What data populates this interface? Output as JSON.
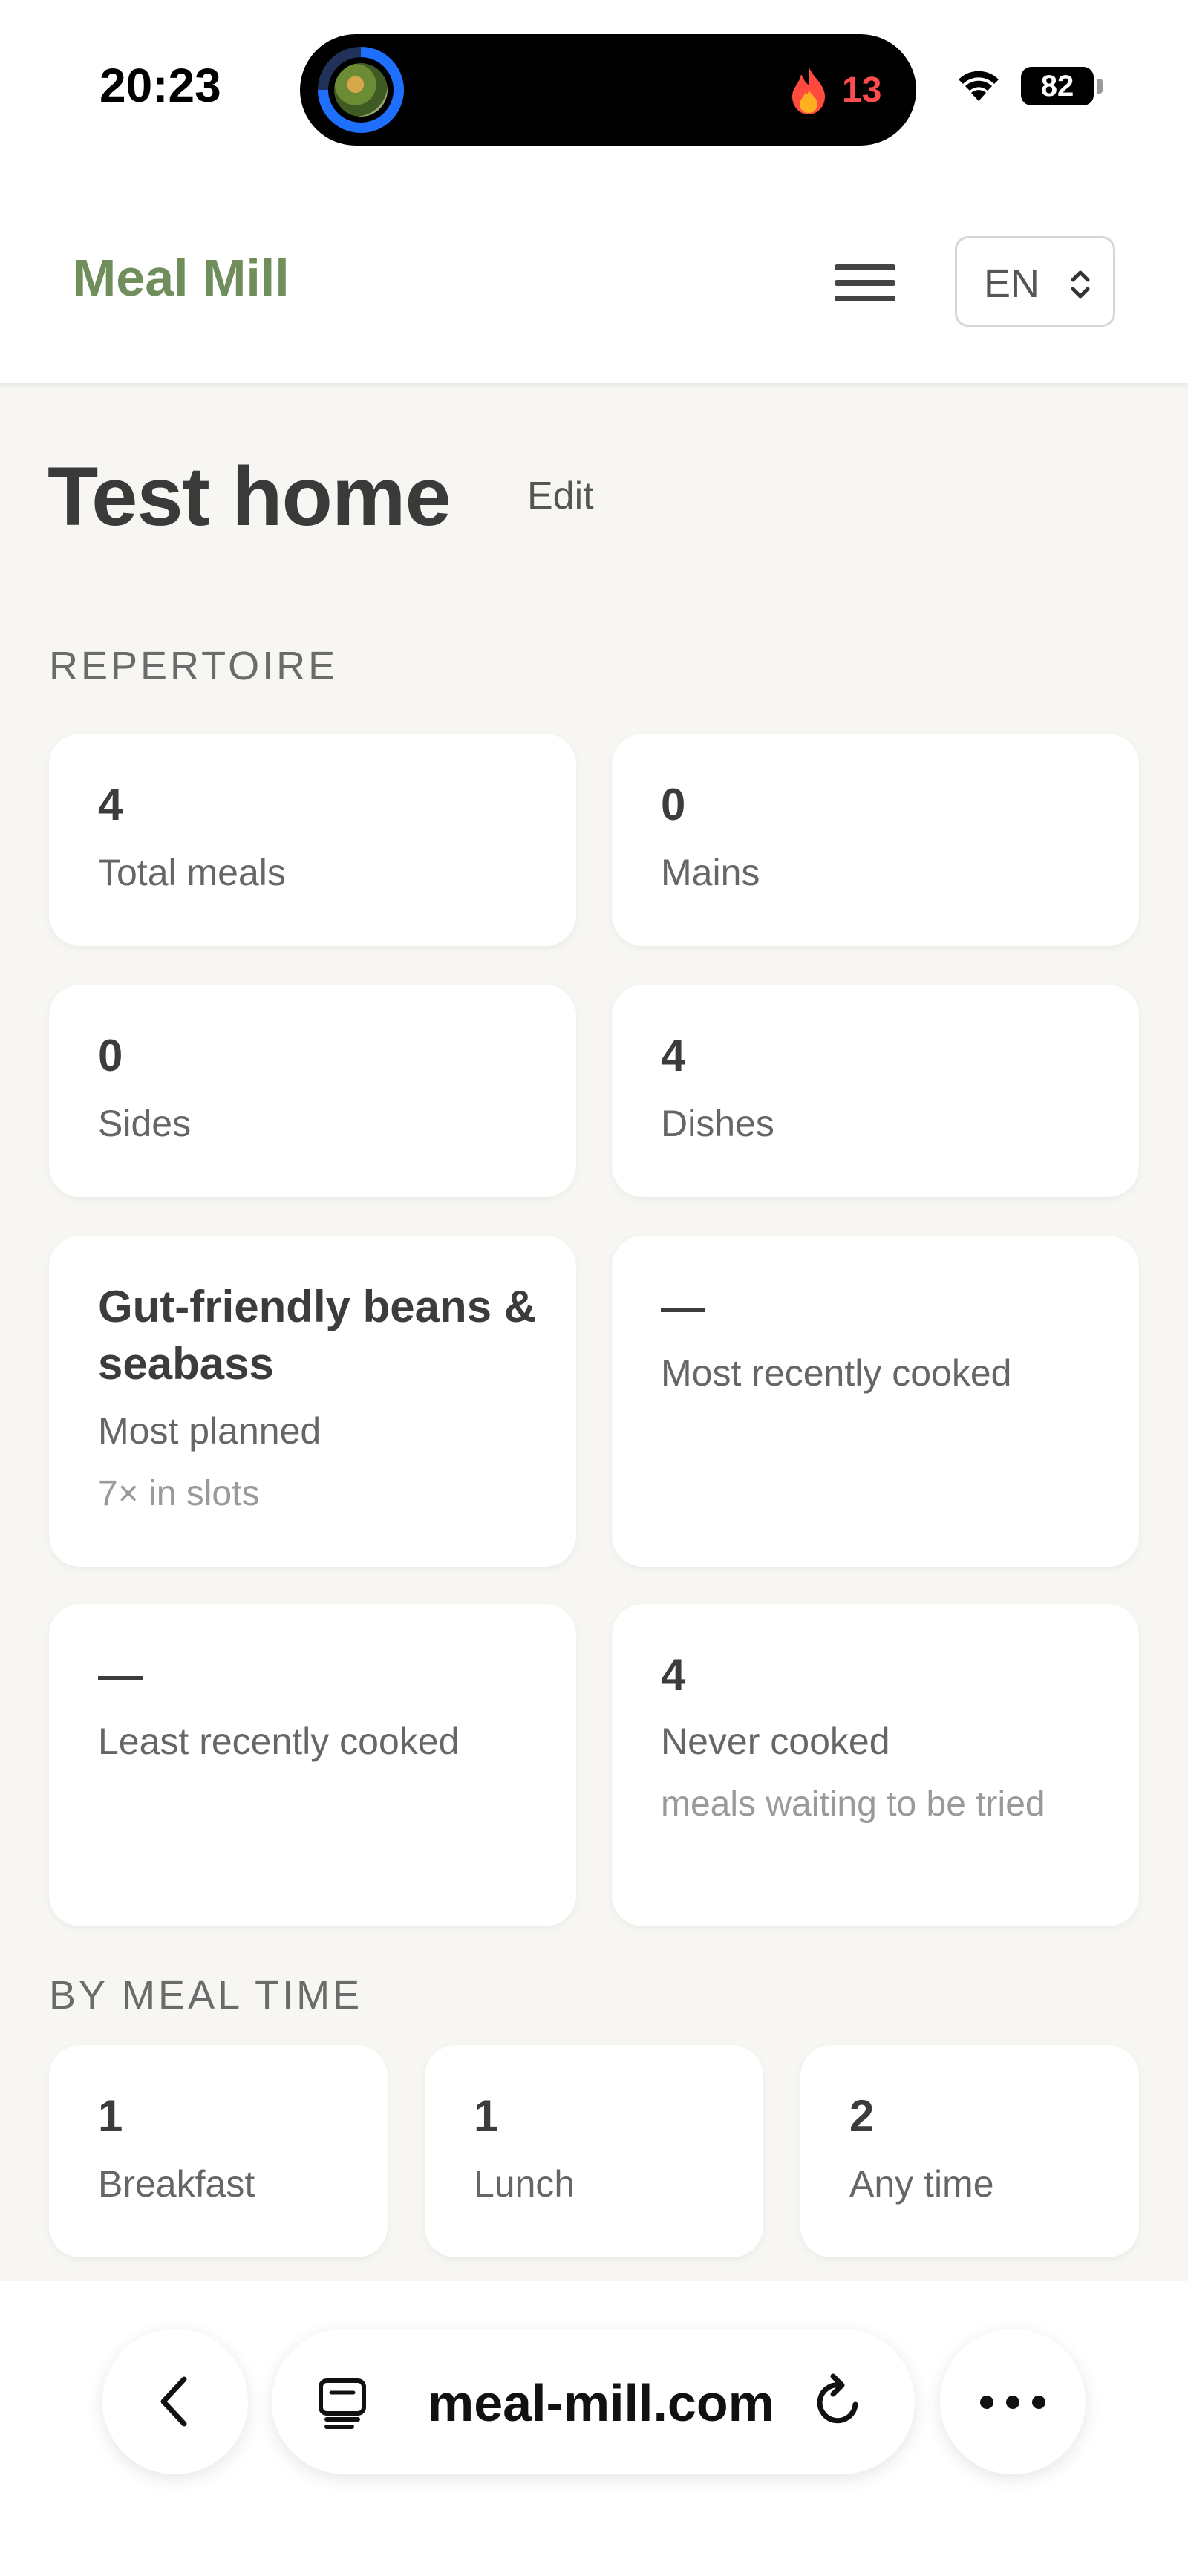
{
  "status_bar": {
    "time": "20:23",
    "activity_count": "13",
    "battery": "82",
    "icons": [
      "food-ring-icon",
      "flame-icon",
      "wifi-icon",
      "battery-icon"
    ]
  },
  "header": {
    "brand": "Meal Mill",
    "language": "EN",
    "icons": [
      "hamburger-menu-icon",
      "chevron-updown-icon"
    ],
    "brand_color": "#6f8e5c"
  },
  "page": {
    "title": "Test home",
    "edit_label": "Edit"
  },
  "repertoire": {
    "heading": "REPERTOIRE",
    "cards": [
      {
        "value": "4",
        "label": "Total meals"
      },
      {
        "value": "0",
        "label": "Mains"
      },
      {
        "value": "0",
        "label": "Sides"
      },
      {
        "value": "4",
        "label": "Dishes"
      },
      {
        "value": "Gut-friendly beans & seabass",
        "label": "Most planned",
        "note": "7× in slots"
      },
      {
        "value": "—",
        "label": "Most recently cooked"
      },
      {
        "value": "—",
        "label": "Least recently cooked"
      },
      {
        "value": "4",
        "label": "Never cooked",
        "note": "meals waiting to be tried"
      }
    ]
  },
  "by_meal_time": {
    "heading": "BY MEAL TIME",
    "cards": [
      {
        "value": "1",
        "label": "Breakfast"
      },
      {
        "value": "1",
        "label": "Lunch"
      },
      {
        "value": "2",
        "label": "Any time"
      }
    ]
  },
  "browser": {
    "url": "meal-mill.com",
    "icons": [
      "back-chevron-icon",
      "tabs-icon",
      "reload-icon",
      "more-dots-icon"
    ]
  }
}
